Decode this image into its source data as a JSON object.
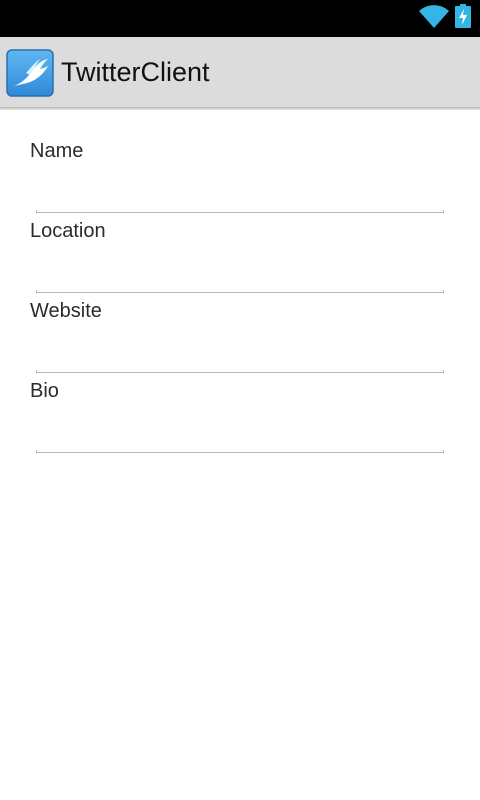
{
  "status_bar": {
    "icons": [
      "wifi-icon",
      "battery-charging-icon"
    ]
  },
  "action_bar": {
    "title": "TwitterClient",
    "icon": "app-bird-icon",
    "background": "#dcdcdc"
  },
  "form": {
    "fields": [
      {
        "label": "Name",
        "value": "",
        "placeholder": ""
      },
      {
        "label": "Location",
        "value": "",
        "placeholder": ""
      },
      {
        "label": "Website",
        "value": "",
        "placeholder": ""
      },
      {
        "label": "Bio",
        "value": "",
        "placeholder": ""
      }
    ]
  },
  "colors": {
    "accent": "#33b5e5",
    "status_bar": "#000000"
  }
}
